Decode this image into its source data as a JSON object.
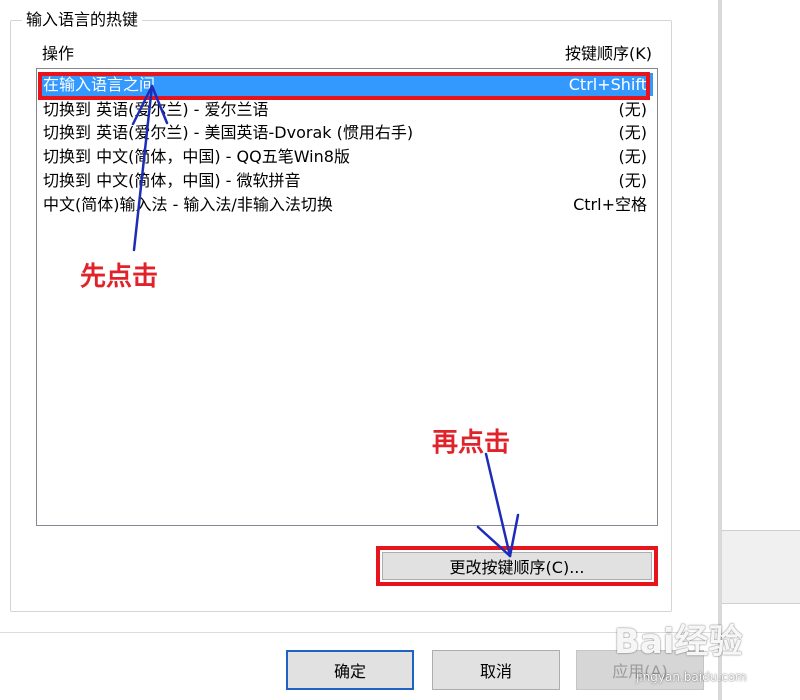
{
  "group": {
    "title": "输入语言的热键"
  },
  "columns": {
    "operation": "操作",
    "key_sequence": "按键顺序(K)"
  },
  "hotkeys": [
    {
      "op": "在输入语言之间",
      "key": "Ctrl+Shift",
      "selected": true
    },
    {
      "op": "切换到 英语(爱尔兰) - 爱尔兰语",
      "key": "(无)"
    },
    {
      "op": "切换到 英语(爱尔兰) - 美国英语-Dvorak (惯用右手)",
      "key": "(无)"
    },
    {
      "op": "切换到 中文(简体，中国) - QQ五笔Win8版",
      "key": "(无)"
    },
    {
      "op": "切换到 中文(简体，中国) - 微软拼音",
      "key": "(无)"
    },
    {
      "op": "中文(简体)输入法 - 输入法/非输入法切换",
      "key": "Ctrl+空格"
    }
  ],
  "buttons": {
    "change_sequence": "更改按键顺序(C)...",
    "ok": "确定",
    "cancel": "取消",
    "apply": "应用(A)"
  },
  "annotations": {
    "first": "先点击",
    "second": "再点击"
  },
  "watermark": {
    "brand": "Bai经验",
    "url": "jingyan.baidu.com"
  },
  "colors": {
    "annotation_red": "#e8141b",
    "arrow_blue": "#1d2db8",
    "selection_blue": "#3399ff"
  }
}
